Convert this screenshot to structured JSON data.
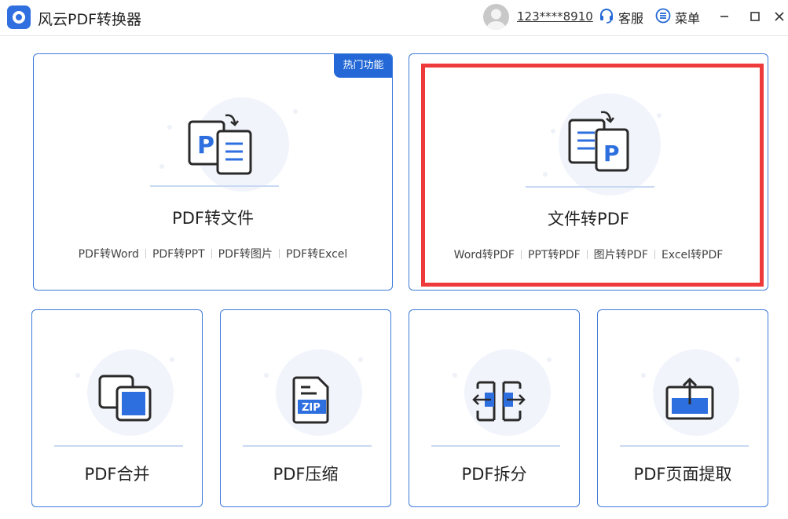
{
  "app": {
    "title": "风云PDF转换器"
  },
  "header": {
    "user_phone": "123****8910",
    "service_label": "客服",
    "menu_label": "菜单"
  },
  "colors": {
    "accent": "#2368d6",
    "card_border": "#3d7bd9",
    "highlight": "#ee3a3a"
  },
  "cards": {
    "pdf_to_file": {
      "title": "PDF转文件",
      "badge": "热门功能",
      "subitems": [
        "PDF转Word",
        "PDF转PPT",
        "PDF转图片",
        "PDF转Excel"
      ]
    },
    "file_to_pdf": {
      "title": "文件转PDF",
      "subitems": [
        "Word转PDF",
        "PPT转PDF",
        "图片转PDF",
        "Excel转PDF"
      ]
    },
    "merge": {
      "title": "PDF合并"
    },
    "compress": {
      "title": "PDF压缩",
      "zip_text": "ZIP"
    },
    "split": {
      "title": "PDF拆分"
    },
    "extract": {
      "title": "PDF页面提取"
    }
  }
}
